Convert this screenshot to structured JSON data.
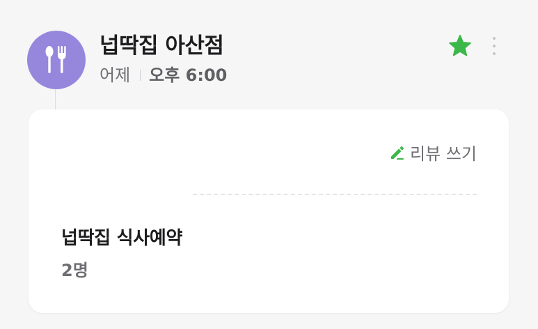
{
  "header": {
    "avatar_icon": "fork-spoon-icon",
    "avatar_color": "#9687dd",
    "place_name": "넙딱집 아산점",
    "date_label": "어제",
    "time_label": "오후 6:00",
    "favorite_icon": "star-icon",
    "favorite_color": "#3cb84a",
    "more_icon": "more-vertical-icon"
  },
  "card": {
    "review_icon": "pencil-icon",
    "review_icon_color": "#3cb84a",
    "review_label": "리뷰 쓰기",
    "reservation_title": "넙딱집 식사예약",
    "party_size": "2명"
  }
}
